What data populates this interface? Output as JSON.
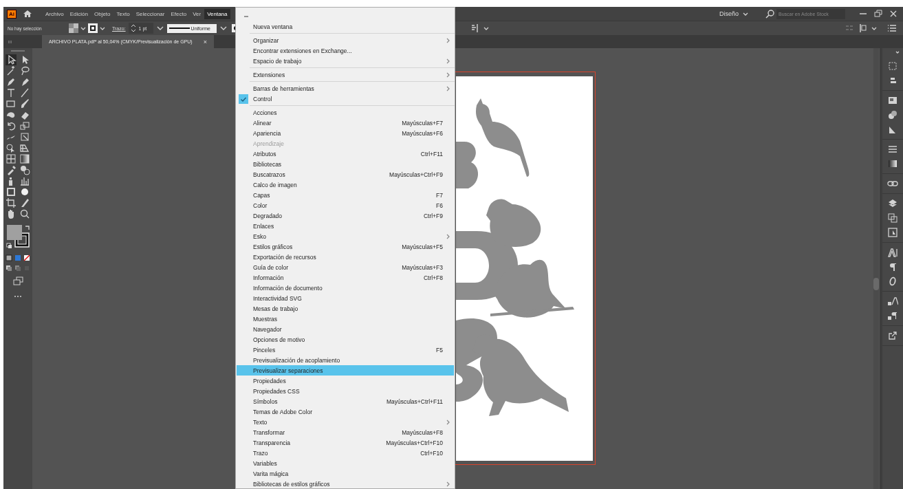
{
  "app_logo": "Ai",
  "menu_bar": {
    "items": [
      {
        "label": "Archivo",
        "selected": false
      },
      {
        "label": "Edición",
        "selected": false
      },
      {
        "label": "Objeto",
        "selected": false
      },
      {
        "label": "Texto",
        "selected": false
      },
      {
        "label": "Seleccionar",
        "selected": false
      },
      {
        "label": "Efecto",
        "selected": false
      },
      {
        "label": "Ver",
        "selected": false
      },
      {
        "label": "Ventana",
        "selected": true
      }
    ]
  },
  "workspace": {
    "label": "Diseño"
  },
  "search": {
    "placeholder": "Buscar en Adobe Stock"
  },
  "control_bar": {
    "selection": "No hay selección",
    "stroke_label": "Trazo:",
    "stroke_weight": "1 pt",
    "stroke_style": "Uniforme"
  },
  "document_tab": {
    "title": "ARCHIVO PLATA.pdf* al 50,04% (CMYK/Previsualización de GPU)",
    "close": "×"
  },
  "window_menu": {
    "items": [
      {
        "kind": "item",
        "label": "Nueva ventana",
        "submenu": false,
        "checked": false,
        "disabled": false,
        "selected": false
      },
      {
        "kind": "separator"
      },
      {
        "kind": "item",
        "label": "Organizar",
        "submenu": true,
        "checked": false,
        "disabled": false,
        "selected": false
      },
      {
        "kind": "item",
        "label": "Encontrar extensiones en Exchange...",
        "submenu": false,
        "checked": false,
        "disabled": false,
        "selected": false
      },
      {
        "kind": "item",
        "label": "Espacio de trabajo",
        "submenu": true,
        "checked": false,
        "disabled": false,
        "selected": false
      },
      {
        "kind": "separator"
      },
      {
        "kind": "item",
        "label": "Extensiones",
        "submenu": true,
        "checked": false,
        "disabled": false,
        "selected": false
      },
      {
        "kind": "separator"
      },
      {
        "kind": "item",
        "label": "Barras de herramientas",
        "submenu": true,
        "checked": false,
        "disabled": false,
        "selected": false
      },
      {
        "kind": "item",
        "label": "Control",
        "submenu": false,
        "checked": true,
        "disabled": false,
        "selected": false
      },
      {
        "kind": "separator"
      },
      {
        "kind": "item",
        "label": "Acciones",
        "submenu": false,
        "checked": false,
        "disabled": false,
        "selected": false
      },
      {
        "kind": "item",
        "label": "Alinear",
        "shortcut": "Mayúsculas+F7",
        "submenu": false,
        "checked": false,
        "disabled": false,
        "selected": false
      },
      {
        "kind": "item",
        "label": "Apariencia",
        "shortcut": "Mayúsculas+F6",
        "submenu": false,
        "checked": false,
        "disabled": false,
        "selected": false
      },
      {
        "kind": "item",
        "label": "Aprendizaje",
        "submenu": false,
        "checked": false,
        "disabled": true,
        "selected": false
      },
      {
        "kind": "item",
        "label": "Atributos",
        "shortcut": "Ctrl+F11",
        "submenu": false,
        "checked": false,
        "disabled": false,
        "selected": false
      },
      {
        "kind": "item",
        "label": "Bibliotecas",
        "submenu": false,
        "checked": false,
        "disabled": false,
        "selected": false
      },
      {
        "kind": "item",
        "label": "Buscatrazos",
        "shortcut": "Mayúsculas+Ctrl+F9",
        "submenu": false,
        "checked": false,
        "disabled": false,
        "selected": false
      },
      {
        "kind": "item",
        "label": "Calco de imagen",
        "submenu": false,
        "checked": false,
        "disabled": false,
        "selected": false
      },
      {
        "kind": "item",
        "label": "Capas",
        "shortcut": "F7",
        "submenu": false,
        "checked": false,
        "disabled": false,
        "selected": false
      },
      {
        "kind": "item",
        "label": "Color",
        "shortcut": "F6",
        "submenu": false,
        "checked": false,
        "disabled": false,
        "selected": false
      },
      {
        "kind": "item",
        "label": "Degradado",
        "shortcut": "Ctrl+F9",
        "submenu": false,
        "checked": false,
        "disabled": false,
        "selected": false
      },
      {
        "kind": "item",
        "label": "Enlaces",
        "submenu": false,
        "checked": false,
        "disabled": false,
        "selected": false
      },
      {
        "kind": "item",
        "label": "Esko",
        "submenu": true,
        "checked": false,
        "disabled": false,
        "selected": false
      },
      {
        "kind": "item",
        "label": "Estilos gráficos",
        "shortcut": "Mayúsculas+F5",
        "submenu": false,
        "checked": false,
        "disabled": false,
        "selected": false
      },
      {
        "kind": "item",
        "label": "Exportación de recursos",
        "submenu": false,
        "checked": false,
        "disabled": false,
        "selected": false
      },
      {
        "kind": "item",
        "label": "Guía de color",
        "shortcut": "Mayúsculas+F3",
        "submenu": false,
        "checked": false,
        "disabled": false,
        "selected": false
      },
      {
        "kind": "item",
        "label": "Información",
        "shortcut": "Ctrl+F8",
        "submenu": false,
        "checked": false,
        "disabled": false,
        "selected": false
      },
      {
        "kind": "item",
        "label": "Información de documento",
        "submenu": false,
        "checked": false,
        "disabled": false,
        "selected": false
      },
      {
        "kind": "item",
        "label": "Interactividad SVG",
        "submenu": false,
        "checked": false,
        "disabled": false,
        "selected": false
      },
      {
        "kind": "item",
        "label": "Mesas de trabajo",
        "submenu": false,
        "checked": false,
        "disabled": false,
        "selected": false
      },
      {
        "kind": "item",
        "label": "Muestras",
        "submenu": false,
        "checked": false,
        "disabled": false,
        "selected": false
      },
      {
        "kind": "item",
        "label": "Navegador",
        "submenu": false,
        "checked": false,
        "disabled": false,
        "selected": false
      },
      {
        "kind": "item",
        "label": "Opciones de motivo",
        "submenu": false,
        "checked": false,
        "disabled": false,
        "selected": false
      },
      {
        "kind": "item",
        "label": "Pinceles",
        "shortcut": "F5",
        "submenu": false,
        "checked": false,
        "disabled": false,
        "selected": false
      },
      {
        "kind": "item",
        "label": "Previsualización de acoplamiento",
        "submenu": false,
        "checked": false,
        "disabled": false,
        "selected": false
      },
      {
        "kind": "item",
        "label": "Previsualizar separaciones",
        "submenu": false,
        "checked": false,
        "disabled": false,
        "selected": true
      },
      {
        "kind": "item",
        "label": "Propiedades",
        "submenu": false,
        "checked": false,
        "disabled": false,
        "selected": false
      },
      {
        "kind": "item",
        "label": "Propiedades CSS",
        "submenu": false,
        "checked": false,
        "disabled": false,
        "selected": false
      },
      {
        "kind": "item",
        "label": "Símbolos",
        "shortcut": "Mayúsculas+Ctrl+F11",
        "submenu": false,
        "checked": false,
        "disabled": false,
        "selected": false
      },
      {
        "kind": "item",
        "label": "Temas de Adobe Color",
        "submenu": false,
        "checked": false,
        "disabled": false,
        "selected": false
      },
      {
        "kind": "item",
        "label": "Texto",
        "submenu": true,
        "checked": false,
        "disabled": false,
        "selected": false
      },
      {
        "kind": "item",
        "label": "Transformar",
        "shortcut": "Mayúsculas+F8",
        "submenu": false,
        "checked": false,
        "disabled": false,
        "selected": false
      },
      {
        "kind": "item",
        "label": "Transparencia",
        "shortcut": "Mayúsculas+Ctrl+F10",
        "submenu": false,
        "checked": false,
        "disabled": false,
        "selected": false
      },
      {
        "kind": "item",
        "label": "Trazo",
        "shortcut": "Ctrl+F10",
        "submenu": false,
        "checked": false,
        "disabled": false,
        "selected": false
      },
      {
        "kind": "item",
        "label": "Variables",
        "submenu": false,
        "checked": false,
        "disabled": false,
        "selected": false
      },
      {
        "kind": "item",
        "label": "Varita mágica",
        "submenu": false,
        "checked": false,
        "disabled": false,
        "selected": false
      },
      {
        "kind": "item",
        "label": "Bibliotecas de estilos gráficos",
        "submenu": true,
        "checked": false,
        "disabled": false,
        "selected": false
      }
    ]
  }
}
